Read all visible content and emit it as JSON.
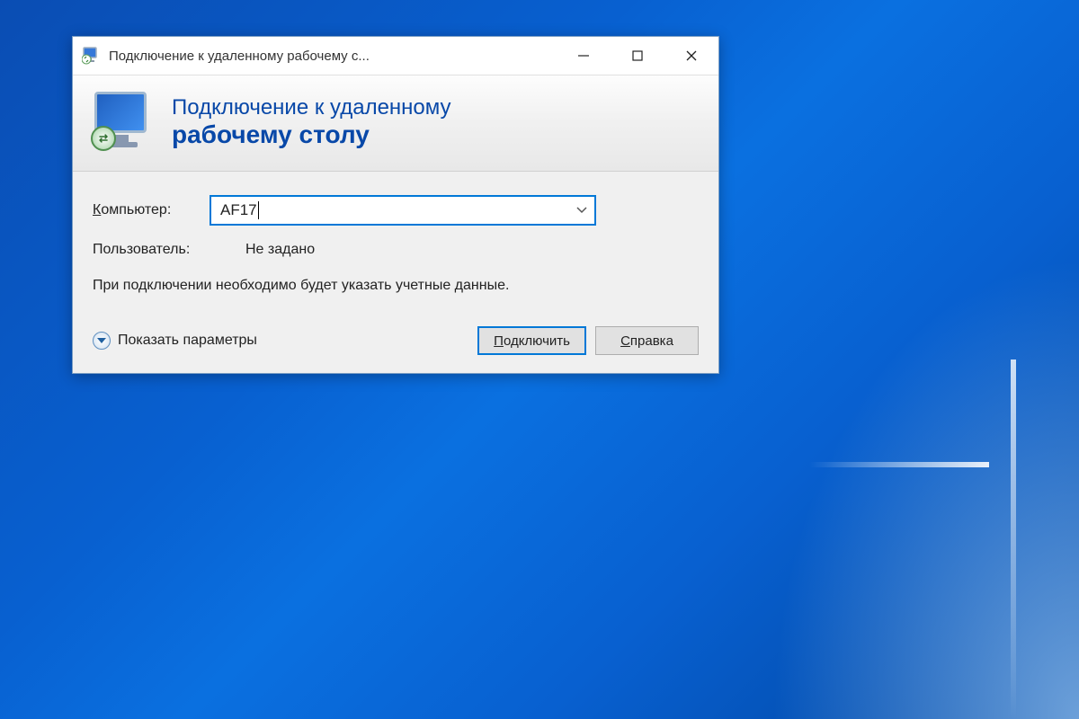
{
  "window": {
    "title": "Подключение к удаленному рабочему с..."
  },
  "header": {
    "line1": "Подключение к удаленному",
    "line2": "рабочему столу"
  },
  "form": {
    "computer_label": "Компьютер:",
    "computer_value": "AF17",
    "user_label": "Пользователь:",
    "user_value": "Не задано",
    "info_text": "При подключении необходимо будет указать учетные данные."
  },
  "footer": {
    "show_options": "Показать параметры",
    "connect": "Подключить",
    "help": "Справка"
  }
}
